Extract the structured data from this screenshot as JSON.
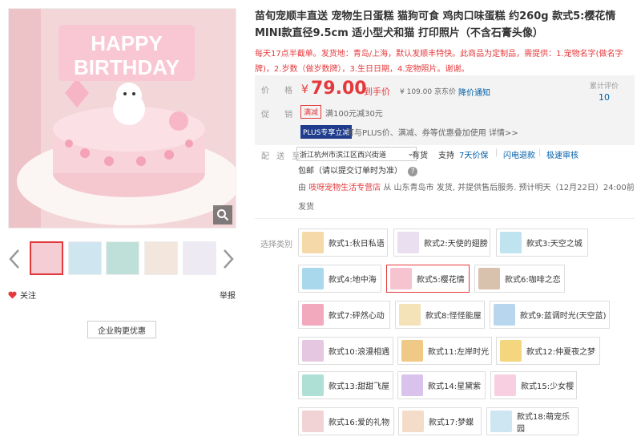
{
  "product": {
    "title": "苗旬宠顺丰直送 宠物生日蛋糕 猫狗可食 鸡肉口味蛋糕 约260g 款式5:樱花情 MINI款直径9.5cm 适小型犬和猫 打印照片（不含石膏头像）",
    "promo": "每天17点半截单。发货地：青岛/上海，默认发顺丰特快。此商品为定制品，需提供：1.宠物名字(做名字牌)，2.岁数（做岁数牌），3.生日日期，4.宠物照片。谢谢。",
    "image_topper_text": "HAPPY BIRTHDAY"
  },
  "price": {
    "label": "价 格",
    "currency": "¥",
    "value": "79.00",
    "final_label": "到手价",
    "jd_price": "¥ 109.00",
    "jd_label": "京东价",
    "notify": "降价通知",
    "eval_label": "累计评价",
    "eval_count": "10"
  },
  "promotion": {
    "label": "促 销",
    "tag": "满减",
    "text": "满100元减30元",
    "plus_tag": "PLUS专享立减",
    "plus_text": "可与PLUS价、满减、券等优惠叠加使用",
    "detail": "详情>>"
  },
  "delivery": {
    "label": "配 送 至",
    "address": "浙江杭州市滨江区西兴街道",
    "stock": "有货",
    "support": "支持",
    "services": [
      "7天价保",
      "闪电退款",
      "极速审核"
    ],
    "shipping": "包邮（请以提交订单时为准）",
    "shop_prefix": "由",
    "shop": "吱呀宠物生活专营店",
    "ship_info": "从 山东青岛市 发货, 并提供售后服务. 预计明天（12月22日）24:00前发货"
  },
  "gallery": {
    "follow": "关注",
    "report": "举报",
    "enterprise": "企业购更优惠"
  },
  "variants": {
    "label": "选择类别",
    "options": [
      {
        "label": "款式1:秋日私语",
        "color": "#f6d9a8"
      },
      {
        "label": "款式2:天使的翅膀",
        "color": "#e9dff0"
      },
      {
        "label": "款式3:天空之城",
        "color": "#bfe3ef"
      },
      {
        "label": "款式4:地中海",
        "color": "#a9d8ec"
      },
      {
        "label": "款式5:樱花情",
        "color": "#f6c4d0"
      },
      {
        "label": "款式6:咖啡之恋",
        "color": "#d8c1ad"
      },
      {
        "label": "款式7:砰然心动",
        "color": "#f2a9bd"
      },
      {
        "label": "款式8:怪怪能屋",
        "color": "#f4e2b8"
      },
      {
        "label": "款式9:蓝调时光(天空蓝)",
        "color": "#b8d6ee"
      },
      {
        "label": "款式10:浪漫相遇",
        "color": "#e5c7e2"
      },
      {
        "label": "款式11:左岸时光",
        "color": "#f0c987"
      },
      {
        "label": "款式12:仲夏夜之梦",
        "color": "#f3d67d"
      },
      {
        "label": "款式13:甜甜飞屋",
        "color": "#aee0d6"
      },
      {
        "label": "款式14:星黛紫",
        "color": "#d9c2ec"
      },
      {
        "label": "款式15:少女樱",
        "color": "#f7cfe0"
      },
      {
        "label": "款式16:爱的礼物",
        "color": "#f1d3d6"
      },
      {
        "label": "款式17:梦蝶",
        "color": "#f3dcc8"
      },
      {
        "label": "款式18:萌宠乐园",
        "color": "#cde6f2"
      }
    ]
  },
  "colors": {
    "accent": "#e4393c",
    "link": "#005ea7",
    "plus": "#1f3d8c"
  }
}
